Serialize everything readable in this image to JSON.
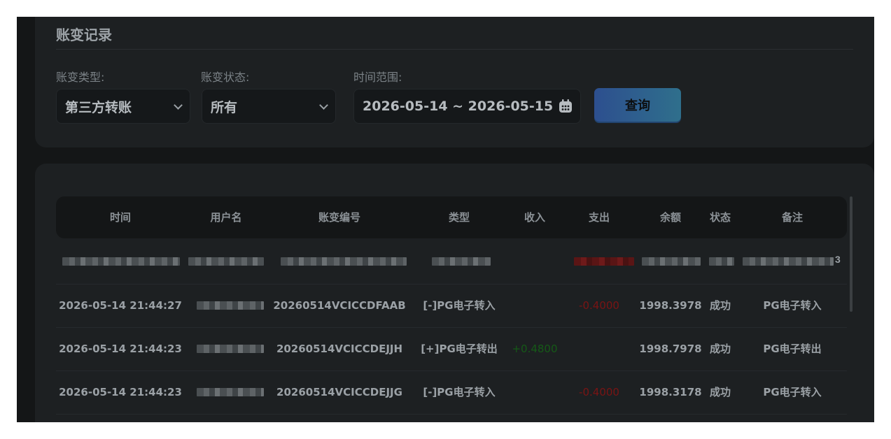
{
  "title": "账变记录",
  "filters": {
    "type_label": "账变类型:",
    "type_value": "第三方转账",
    "status_label": "账变状态:",
    "status_value": "所有",
    "range_label": "时间范围:",
    "range_value": "2026-05-14 ~ 2026-05-15",
    "query_button": "查询"
  },
  "table": {
    "headers": [
      "时间",
      "用户名",
      "账变编号",
      "类型",
      "收入",
      "支出",
      "余额",
      "状态",
      "备注"
    ],
    "blurred_row_trailing": "3",
    "rows": [
      {
        "time": "2026-05-14 21:44:27",
        "id": "20260514VCICCDFAAB",
        "type": "[-]PG电子转入",
        "income": "",
        "expense": "-0.4000",
        "balance": "1998.3978",
        "status": "成功",
        "note": "PG电子转入"
      },
      {
        "time": "2026-05-14 21:44:23",
        "id": "20260514VCICCDEJJH",
        "type": "[+]PG电子转出",
        "income": "+0.4800",
        "expense": "",
        "balance": "1998.7978",
        "status": "成功",
        "note": "PG电子转出"
      },
      {
        "time": "2026-05-14 21:44:23",
        "id": "20260514VCICCDEJJG",
        "type": "[-]PG电子转入",
        "income": "",
        "expense": "-0.4000",
        "balance": "1998.3178",
        "status": "成功",
        "note": "PG电子转入"
      }
    ]
  },
  "colors": {
    "negative": "#7a1414",
    "positive": "#155a17",
    "button": "#2d4f8f"
  }
}
